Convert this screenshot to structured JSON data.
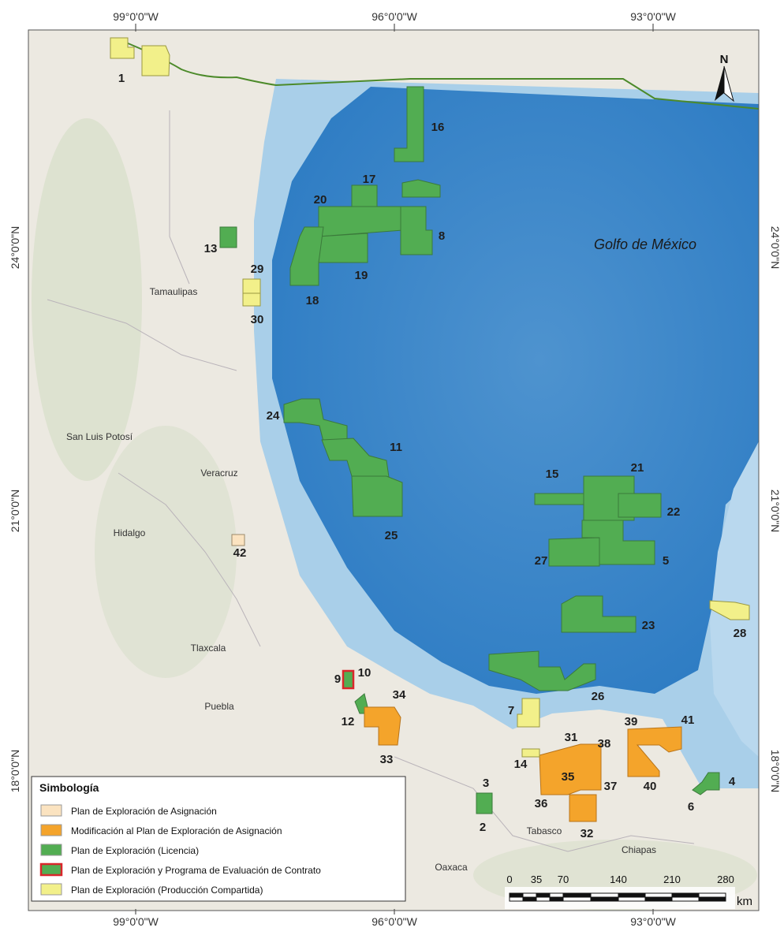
{
  "graticule": {
    "top": [
      "99°0'0\"W",
      "96°0'0\"W",
      "93°0'0\"W"
    ],
    "bottom": [
      "99°0'0\"W",
      "96°0'0\"W",
      "93°0'0\"W"
    ],
    "left": [
      "24°0'0\"N",
      "21°0'0\"N",
      "18°0'0\"N"
    ],
    "right": [
      "24°0'0\"N",
      "21°0'0\"N",
      "18°0'0\"N"
    ]
  },
  "north_arrow": {
    "label": "N"
  },
  "sea_label": "Golfo de México",
  "place_labels": {
    "tamaulipas": "Tamaulipas",
    "san_luis_potosi": "San Luis Potosí",
    "veracruz": "Veracruz",
    "hidalgo": "Hidalgo",
    "tlaxcala": "Tlaxcala",
    "puebla": "Puebla",
    "tabasco": "Tabasco",
    "oaxaca": "Oaxaca",
    "chiapas": "Chiapas"
  },
  "block_labels": {
    "b1": "1",
    "b2": "2",
    "b3": "3",
    "b4": "4",
    "b5": "5",
    "b6": "6",
    "b7": "7",
    "b8": "8",
    "b9": "9",
    "b10": "10",
    "b11": "11",
    "b12": "12",
    "b13": "13",
    "b14": "14",
    "b15": "15",
    "b16": "16",
    "b17": "17",
    "b18": "18",
    "b19": "19",
    "b20": "20",
    "b21": "21",
    "b22": "22",
    "b23": "23",
    "b24": "24",
    "b25": "25",
    "b26": "26",
    "b27": "27",
    "b28": "28",
    "b29": "29",
    "b30": "30",
    "b31": "31",
    "b32": "32",
    "b33": "33",
    "b34": "34",
    "b35": "35",
    "b36": "36",
    "b37": "37",
    "b38": "38",
    "b39": "39",
    "b40": "40",
    "b41": "41",
    "b42": "42"
  },
  "legend": {
    "title": "Simbología",
    "items": [
      {
        "label": "Plan de Exploración de Asignación",
        "color": "#fbe3c0"
      },
      {
        "label": "Modificación al Plan de Exploración de Asignación",
        "color": "#f4a42b"
      },
      {
        "label": "Plan de Exploración (Licencia)",
        "color": "#52ad52"
      },
      {
        "label": "Plan de Exploración y Programa de Evaluación de Contrato",
        "color": "#52ad52",
        "border": "#d9262b"
      },
      {
        "label": "Plan de Exploración (Producción Compartida)",
        "color": "#f2f08a"
      }
    ]
  },
  "scale_bar": {
    "ticks": [
      "0",
      "35",
      "70",
      "140",
      "210",
      "280"
    ],
    "unit": "km"
  },
  "colors": {
    "sea_deep": "#3f8ccc",
    "sea_shelf": "#a9cfe9",
    "land": "#ece9e1",
    "green_block": "#52ad52",
    "orange_block": "#f4a42b",
    "yellow_block": "#f2f08a",
    "beige_block": "#fbe3c0"
  }
}
